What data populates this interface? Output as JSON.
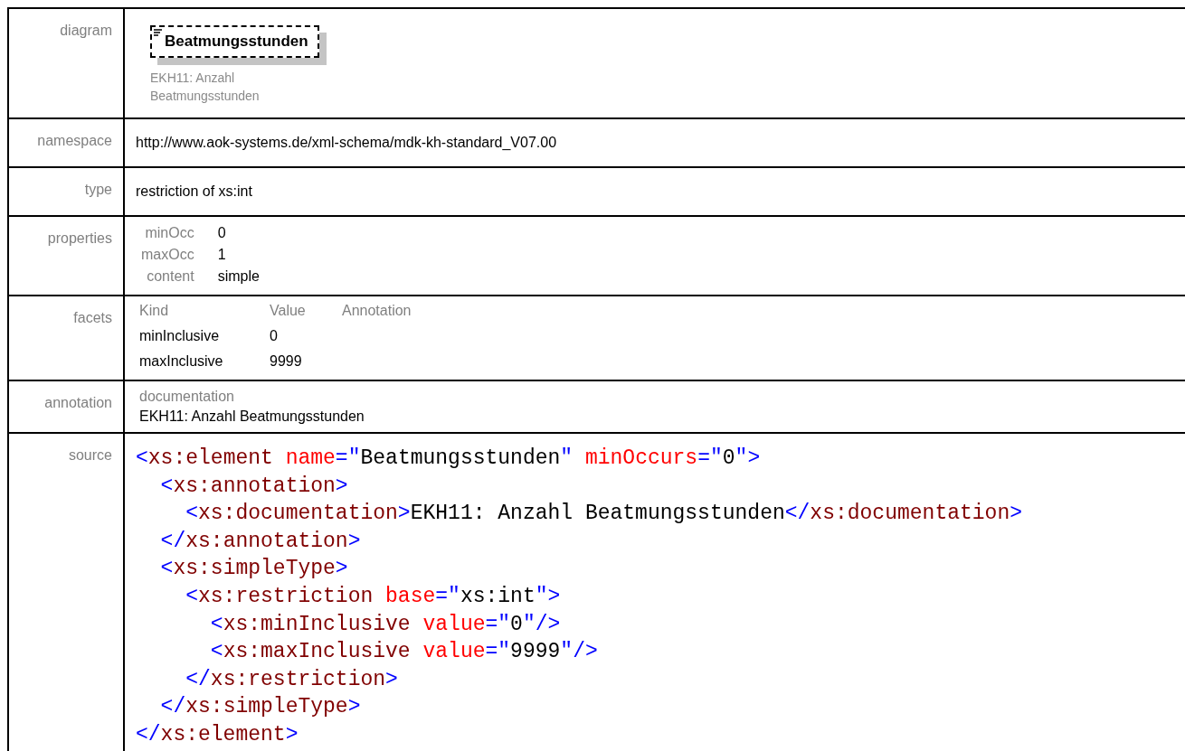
{
  "rows": [
    {
      "kind": "diagram",
      "label": "diagram",
      "element_name": "Beatmungsstunden",
      "element_annotation": "EKH11: Anzahl\nBeatmungsstunden"
    },
    {
      "kind": "text",
      "label": "namespace",
      "value": "http://www.aok-systems.de/xml-schema/mdk-kh-standard_V07.00"
    },
    {
      "kind": "text",
      "label": "type",
      "value": "restriction of xs:int"
    },
    {
      "kind": "properties",
      "label": "properties",
      "items": [
        {
          "name": "minOcc",
          "value": "0"
        },
        {
          "name": "maxOcc",
          "value": "1"
        },
        {
          "name": "content",
          "value": "simple"
        }
      ]
    },
    {
      "kind": "facets",
      "label": "facets",
      "columns": [
        "Kind",
        "Value",
        "Annotation"
      ],
      "facets": [
        {
          "kind": "minInclusive",
          "value": "0"
        },
        {
          "kind": "maxInclusive",
          "value": "9999"
        }
      ]
    },
    {
      "kind": "annotation",
      "label": "annotation",
      "heading": "documentation",
      "text": "EKH11: Anzahl Beatmungsstunden"
    },
    {
      "kind": "source",
      "label": "source",
      "lines": [
        [
          {
            "kind": "punct",
            "text": "<"
          },
          {
            "kind": "tag",
            "text": "xs:element"
          },
          {
            "kind": "attr",
            "text": " name"
          },
          {
            "kind": "punct",
            "text": "=\""
          },
          {
            "kind": "value",
            "text": "Beatmungsstunden"
          },
          {
            "kind": "punct",
            "text": "\""
          },
          {
            "kind": "attr",
            "text": " minOccurs"
          },
          {
            "kind": "punct",
            "text": "=\""
          },
          {
            "kind": "value",
            "text": "0"
          },
          {
            "kind": "punct",
            "text": "\">"
          }
        ],
        [
          {
            "kind": "punct",
            "text": "  <"
          },
          {
            "kind": "tag",
            "text": "xs:annotation"
          },
          {
            "kind": "punct",
            "text": ">"
          }
        ],
        [
          {
            "kind": "punct",
            "text": "    <"
          },
          {
            "kind": "tag",
            "text": "xs:documentation"
          },
          {
            "kind": "punct",
            "text": ">"
          },
          {
            "kind": "value",
            "text": "EKH11: Anzahl Beatmungsstunden"
          },
          {
            "kind": "punct",
            "text": "</"
          },
          {
            "kind": "tag",
            "text": "xs:documentation"
          },
          {
            "kind": "punct",
            "text": ">"
          }
        ],
        [
          {
            "kind": "punct",
            "text": "  </"
          },
          {
            "kind": "tag",
            "text": "xs:annotation"
          },
          {
            "kind": "punct",
            "text": ">"
          }
        ],
        [
          {
            "kind": "punct",
            "text": "  <"
          },
          {
            "kind": "tag",
            "text": "xs:simpleType"
          },
          {
            "kind": "punct",
            "text": ">"
          }
        ],
        [
          {
            "kind": "punct",
            "text": "    <"
          },
          {
            "kind": "tag",
            "text": "xs:restriction"
          },
          {
            "kind": "attr",
            "text": " base"
          },
          {
            "kind": "punct",
            "text": "=\""
          },
          {
            "kind": "value",
            "text": "xs:int"
          },
          {
            "kind": "punct",
            "text": "\">"
          }
        ],
        [
          {
            "kind": "punct",
            "text": "      <"
          },
          {
            "kind": "tag",
            "text": "xs:minInclusive"
          },
          {
            "kind": "attr",
            "text": " value"
          },
          {
            "kind": "punct",
            "text": "=\""
          },
          {
            "kind": "value",
            "text": "0"
          },
          {
            "kind": "punct",
            "text": "\"/>"
          }
        ],
        [
          {
            "kind": "punct",
            "text": "      <"
          },
          {
            "kind": "tag",
            "text": "xs:maxInclusive"
          },
          {
            "kind": "attr",
            "text": " value"
          },
          {
            "kind": "punct",
            "text": "=\""
          },
          {
            "kind": "value",
            "text": "9999"
          },
          {
            "kind": "punct",
            "text": "\"/>"
          }
        ],
        [
          {
            "kind": "punct",
            "text": "    </"
          },
          {
            "kind": "tag",
            "text": "xs:restriction"
          },
          {
            "kind": "punct",
            "text": ">"
          }
        ],
        [
          {
            "kind": "punct",
            "text": "  </"
          },
          {
            "kind": "tag",
            "text": "xs:simpleType"
          },
          {
            "kind": "punct",
            "text": ">"
          }
        ],
        [
          {
            "kind": "punct",
            "text": "</"
          },
          {
            "kind": "tag",
            "text": "xs:element"
          },
          {
            "kind": "punct",
            "text": ">"
          }
        ]
      ]
    }
  ]
}
